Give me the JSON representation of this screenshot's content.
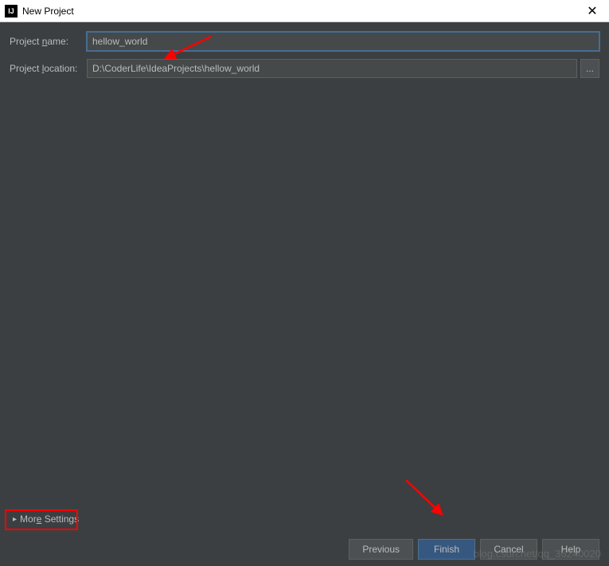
{
  "titlebar": {
    "icon_text": "IJ",
    "title": "New Project",
    "close_symbol": "✕"
  },
  "form": {
    "project_name_label": "Project name:",
    "project_name_value": "hellow_world",
    "project_location_label": "Project location:",
    "project_location_value": "D:\\CoderLife\\IdeaProjects\\hellow_world",
    "browse_label": "..."
  },
  "more_settings": {
    "arrow": "▸",
    "label": "More Settings"
  },
  "buttons": {
    "previous": "Previous",
    "finish": "Finish",
    "cancel": "Cancel",
    "help": "Help"
  },
  "watermark": "blog.csdn.net/qq_36240020"
}
